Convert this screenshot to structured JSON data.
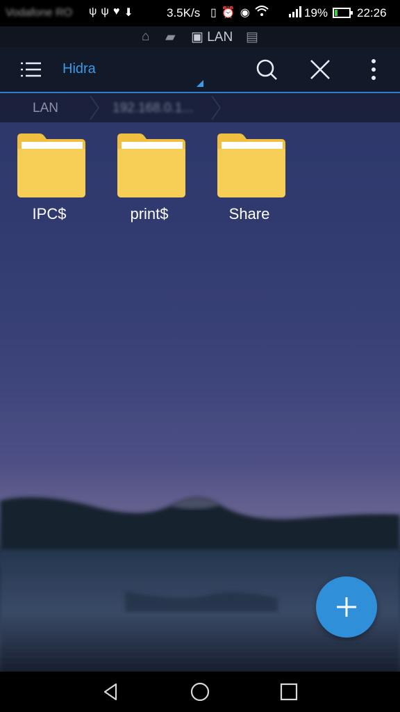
{
  "status_bar": {
    "carrier": "Vodafone RO",
    "net_speed": "3.5K/s",
    "battery_percent": "19%",
    "battery_level": 0.19,
    "time": "22:26",
    "icons": [
      "usb-icon",
      "usb-icon",
      "heart-rate-icon",
      "download-icon",
      "vibrate-icon",
      "alarm-icon",
      "eye-icon",
      "wifi-icon",
      "signal-icon",
      "battery-charging-icon"
    ]
  },
  "network_bar": {
    "items": [
      {
        "icon": "home-icon"
      },
      {
        "icon": "chat-icon"
      },
      {
        "icon": "computer-icon",
        "label": "LAN"
      },
      {
        "icon": "printer-icon"
      }
    ]
  },
  "toolbar": {
    "title": "Hidra",
    "icons": [
      "menu-icon",
      "search-icon",
      "close-icon",
      "more-vertical-icon"
    ]
  },
  "breadcrumb": {
    "items": [
      "LAN",
      "192.168.0.1..."
    ]
  },
  "folders": [
    {
      "name": "IPC$"
    },
    {
      "name": "print$"
    },
    {
      "name": "Share"
    }
  ],
  "fab": {
    "icon": "plus-icon"
  },
  "nav_bar": {
    "icons": [
      "back-icon",
      "home-circle-icon",
      "recents-icon"
    ]
  },
  "colors": {
    "accent": "#3d9ae6",
    "folder": "#f5c94d",
    "fab": "#2f8fd9",
    "toolbar_bg": "#121a2a"
  }
}
